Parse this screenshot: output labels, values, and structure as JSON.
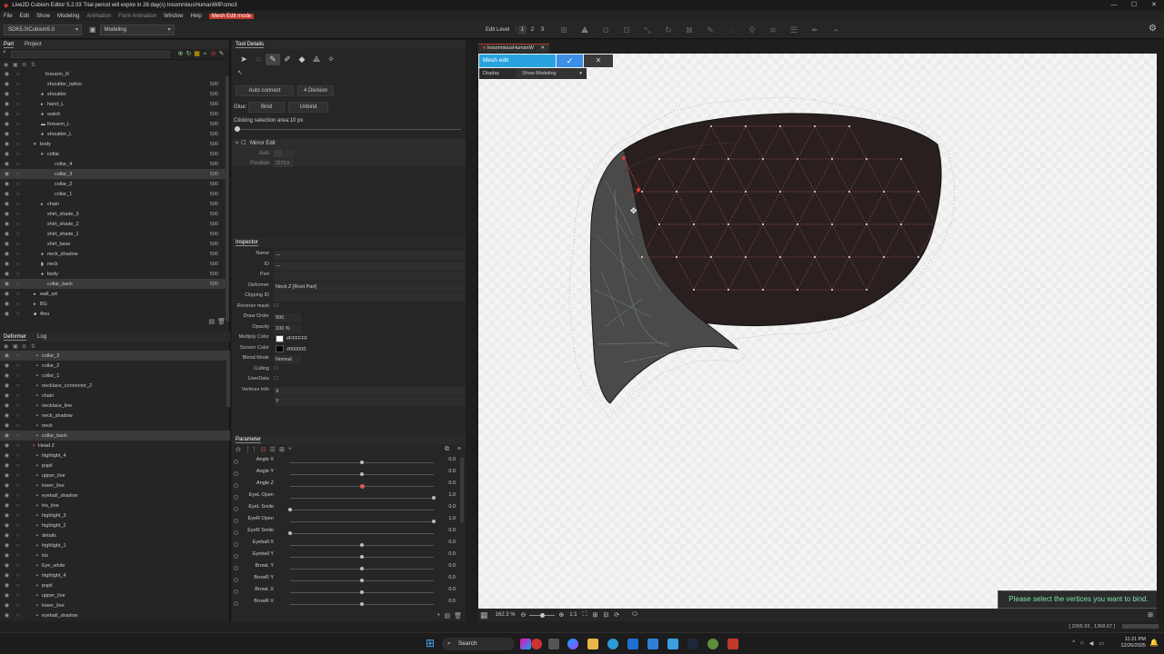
{
  "title": "Live2D Cubism Editor 5.2.03    Trial period will expire in 26 day(s)    InsomniousHumanWIP.cmo3",
  "window_controls": [
    "—",
    "☐",
    "✕"
  ],
  "menu": [
    "File",
    "Edit",
    "Show",
    "Modeling",
    "Animation",
    "Form Animation",
    "Window",
    "Help",
    "Mesh Edit mode"
  ],
  "toolbar": {
    "sdk": "SDK5.0/Cubism5.0",
    "workspace": "Modeling",
    "edit_level_label": "Edit Level",
    "edit_levels": [
      "1",
      "2",
      "3"
    ]
  },
  "part_panel": {
    "tabs": [
      "Part",
      "Project"
    ],
    "rows": [
      {
        "label": "forearm_R",
        "value": "",
        "indent": 50,
        "icon": ""
      },
      {
        "label": "shoulder_tattoo",
        "value": "500",
        "indent": 52,
        "icon": ""
      },
      {
        "label": "shoulder",
        "value": "500",
        "indent": 52,
        "icon": "●"
      },
      {
        "label": "hand_L",
        "value": "500",
        "indent": 52,
        "icon": "▸"
      },
      {
        "label": "watch",
        "value": "500",
        "indent": 52,
        "icon": "●"
      },
      {
        "label": "forearm_L",
        "value": "500",
        "indent": 52,
        "icon": "▬"
      },
      {
        "label": "shoulder_L",
        "value": "500",
        "indent": 52,
        "icon": "●"
      },
      {
        "label": "body",
        "value": "500",
        "indent": 44,
        "icon": "▾"
      },
      {
        "label": "collar",
        "value": "500",
        "indent": 52,
        "icon": "▾"
      },
      {
        "label": "collar_4",
        "value": "500",
        "indent": 60,
        "icon": ""
      },
      {
        "label": "collar_3",
        "value": "500",
        "indent": 60,
        "icon": ""
      },
      {
        "label": "collar_2",
        "value": "500",
        "indent": 60,
        "icon": ""
      },
      {
        "label": "collar_1",
        "value": "500",
        "indent": 60,
        "icon": ""
      },
      {
        "label": "chain",
        "value": "500",
        "indent": 52,
        "icon": "▸"
      },
      {
        "label": "shirt_shade_3",
        "value": "500",
        "indent": 52,
        "icon": ""
      },
      {
        "label": "shirt_shade_2",
        "value": "500",
        "indent": 52,
        "icon": ""
      },
      {
        "label": "shirt_shade_1",
        "value": "500",
        "indent": 52,
        "icon": ""
      },
      {
        "label": "shirt_base",
        "value": "500",
        "indent": 52,
        "icon": ""
      },
      {
        "label": "neck_shadow",
        "value": "500",
        "indent": 52,
        "icon": "●"
      },
      {
        "label": "neck",
        "value": "500",
        "indent": 52,
        "icon": "▮"
      },
      {
        "label": "body",
        "value": "500",
        "indent": 52,
        "icon": "●"
      },
      {
        "label": "collar_back",
        "value": "500",
        "indent": 52,
        "icon": ""
      },
      {
        "label": "wall_art",
        "value": "",
        "indent": 44,
        "icon": "▸"
      },
      {
        "label": "BG",
        "value": "",
        "indent": 44,
        "icon": "▸"
      },
      {
        "label": "Фон",
        "value": "",
        "indent": 44,
        "icon": "■"
      }
    ]
  },
  "deformer_panel": {
    "tabs": [
      "Deformer",
      "Log"
    ],
    "rows": [
      {
        "label": "collar_3",
        "indent": 46
      },
      {
        "label": "collar_2",
        "indent": 46
      },
      {
        "label": "collar_1",
        "indent": 46
      },
      {
        "label": "necklace_connector_2",
        "indent": 46
      },
      {
        "label": "chain",
        "indent": 46
      },
      {
        "label": "necklace_line",
        "indent": 46
      },
      {
        "label": "neck_shadow",
        "indent": 46
      },
      {
        "label": "neck",
        "indent": 46
      },
      {
        "label": "collar_back",
        "indent": 46
      },
      {
        "label": "Head Z",
        "indent": 42
      },
      {
        "label": "highlight_4",
        "indent": 46
      },
      {
        "label": "pupil",
        "indent": 46
      },
      {
        "label": "upper_line",
        "indent": 46
      },
      {
        "label": "lower_line",
        "indent": 46
      },
      {
        "label": "eyeball_shadow",
        "indent": 46
      },
      {
        "label": "iris_line",
        "indent": 46
      },
      {
        "label": "highlight_3",
        "indent": 46
      },
      {
        "label": "highlight_2",
        "indent": 46
      },
      {
        "label": "details",
        "indent": 46
      },
      {
        "label": "highlight_1",
        "indent": 46
      },
      {
        "label": "iris",
        "indent": 46
      },
      {
        "label": "Eye_white",
        "indent": 46
      },
      {
        "label": "highlight_4",
        "indent": 46
      },
      {
        "label": "pupil",
        "indent": 46
      },
      {
        "label": "upper_line",
        "indent": 46
      },
      {
        "label": "lower_line",
        "indent": 46
      },
      {
        "label": "eyeball_shadow",
        "indent": 46
      }
    ]
  },
  "tool_details": {
    "title": "Tool Details",
    "auto_connect": "Auto connect",
    "division": "4 Division",
    "glue_label": "Glue:",
    "bind": "Bind",
    "unbind": "Unbind",
    "clicking_area": "Clicking selection area:10 px",
    "mirror_edit": "Mirror Edit",
    "axis_label": "Axis",
    "position_label": "Position",
    "position_value": "2276.0"
  },
  "inspector": {
    "title": "Inspector",
    "rows": [
      {
        "key": "Name",
        "value": "---"
      },
      {
        "key": "ID",
        "value": "---"
      },
      {
        "key": "Part",
        "value": ""
      },
      {
        "key": "Deformer",
        "value": "Neck Z  [Root Part]"
      },
      {
        "key": "Clipping ID",
        "value": ""
      },
      {
        "key": "Reverse mask",
        "value": ""
      },
      {
        "key": "Draw Order",
        "value": "500"
      },
      {
        "key": "Opacity",
        "value": "100 %"
      },
      {
        "key": "Multiply Color",
        "value": "#FFFFFF"
      },
      {
        "key": "Screen Color",
        "value": "#000000"
      },
      {
        "key": "Blend Mode",
        "value": "Normal"
      },
      {
        "key": "Culling",
        "value": ""
      },
      {
        "key": "UserData",
        "value": ""
      },
      {
        "key": "Vertices Info",
        "value": "X"
      },
      {
        "key": "",
        "value": "Y"
      }
    ]
  },
  "parameters": {
    "title": "Parameter",
    "rows": [
      {
        "name": "Angle X",
        "value": "0.0",
        "pos": 0.5,
        "accent": false
      },
      {
        "name": "Angle Y",
        "value": "0.0",
        "pos": 0.5,
        "accent": false
      },
      {
        "name": "Angle Z",
        "value": "0.0",
        "pos": 0.5,
        "accent": true
      },
      {
        "name": "EyeL Open",
        "value": "1.0",
        "pos": 1.0,
        "accent": false
      },
      {
        "name": "EyeL Smile",
        "value": "0.0",
        "pos": 0.0,
        "accent": false
      },
      {
        "name": "EyeR Open",
        "value": "1.0",
        "pos": 1.0,
        "accent": false
      },
      {
        "name": "EyeR Smile",
        "value": "0.0",
        "pos": 0.0,
        "accent": false
      },
      {
        "name": "Eyeball X",
        "value": "0.0",
        "pos": 0.5,
        "accent": false
      },
      {
        "name": "Eyeball Y",
        "value": "0.0",
        "pos": 0.5,
        "accent": false
      },
      {
        "name": "BrowL Y",
        "value": "0.0",
        "pos": 0.5,
        "accent": false
      },
      {
        "name": "BrowR Y",
        "value": "0.0",
        "pos": 0.5,
        "accent": false
      },
      {
        "name": "BrowL X",
        "value": "0.0",
        "pos": 0.5,
        "accent": false
      },
      {
        "name": "BrowR X",
        "value": "0.0",
        "pos": 0.5,
        "accent": false
      }
    ]
  },
  "viewport": {
    "doc_tab": "InsomniousHumanW",
    "mesh_edit": "Mesh edit",
    "display_label": "Display",
    "display_value": "Show Modeling",
    "toast": "Please select the vertices you want to bind.",
    "zoom": "162.3 %",
    "ratio": "1:1"
  },
  "status": {
    "coords": "[ 2065.93 , 1368.67 ]"
  },
  "taskbar": {
    "search": "Search",
    "time": "11:21 PM",
    "date": "12/26/2025"
  },
  "colors": {
    "accent": "#c0392b",
    "mesh_edit": "#29a3e0",
    "toast_text": "#7de0ac",
    "mesh_fill": "#2a1f1f"
  }
}
